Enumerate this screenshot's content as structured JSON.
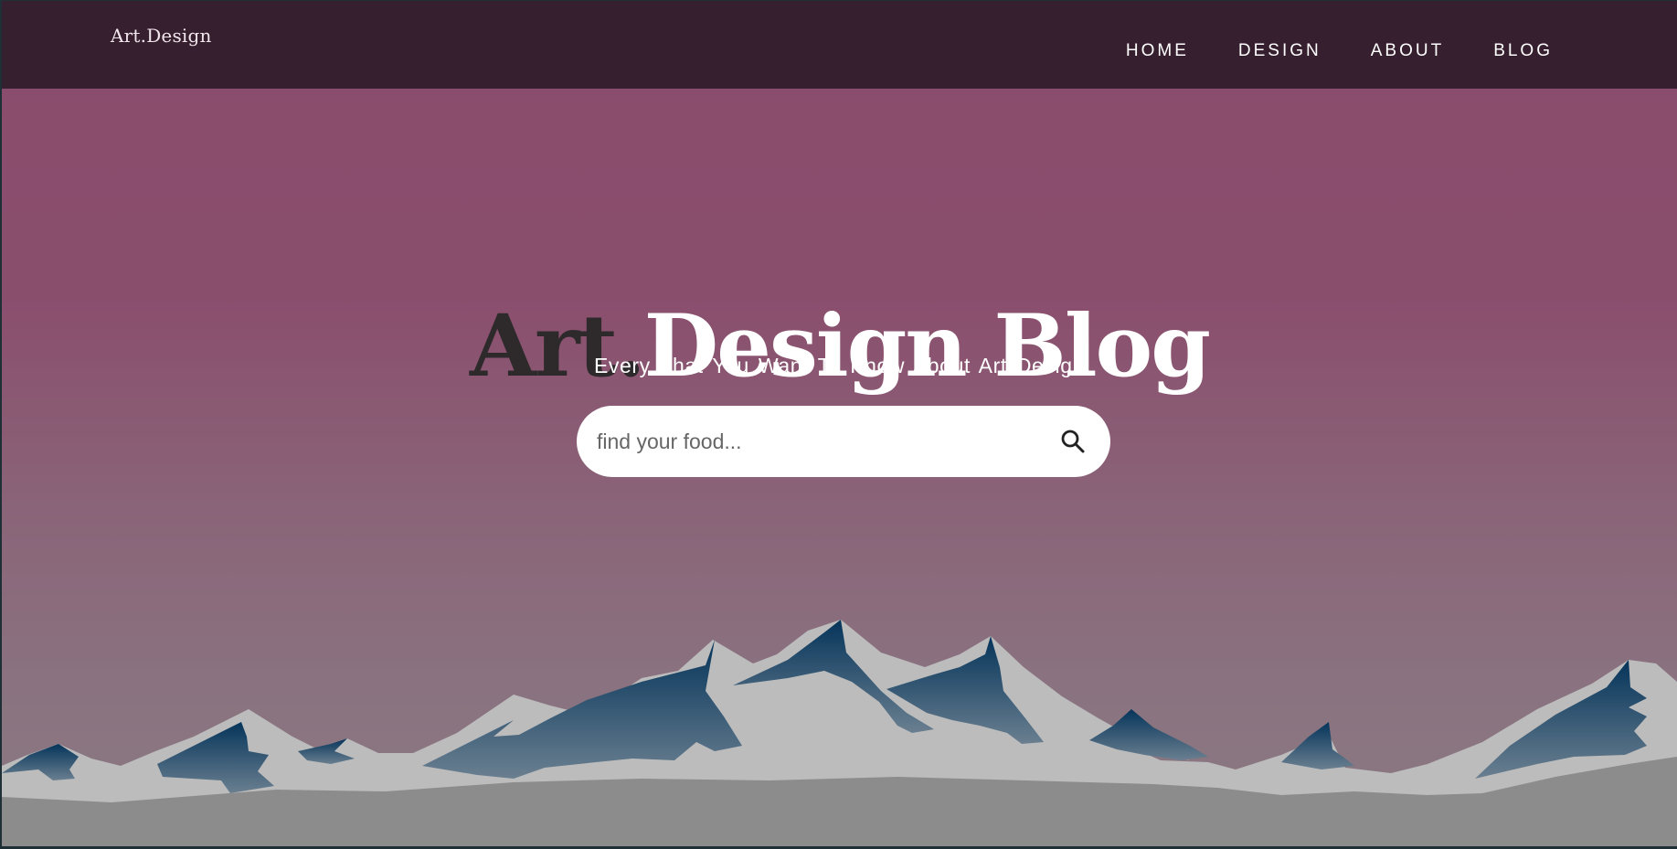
{
  "brand": {
    "logo": "Art.Design"
  },
  "nav": {
    "items": [
      {
        "label": "HOME"
      },
      {
        "label": "DESIGN"
      },
      {
        "label": "ABOUT"
      },
      {
        "label": "BLOG"
      }
    ]
  },
  "hero": {
    "title_dark": "Art.",
    "title_light": "Design Blog",
    "subtitle": "Every That You Want To Know About Art Design"
  },
  "search": {
    "placeholder": "find your food...",
    "value": "",
    "icon": "search-icon"
  },
  "colors": {
    "navbar": "#361f2e",
    "hero_top": "#8a4c6c",
    "hero_bottom": "#8a7a82",
    "mountain_snow": "#bdbdbd",
    "mountain_shadow": "#0b3a5e",
    "ground": "#8c8c8c"
  }
}
